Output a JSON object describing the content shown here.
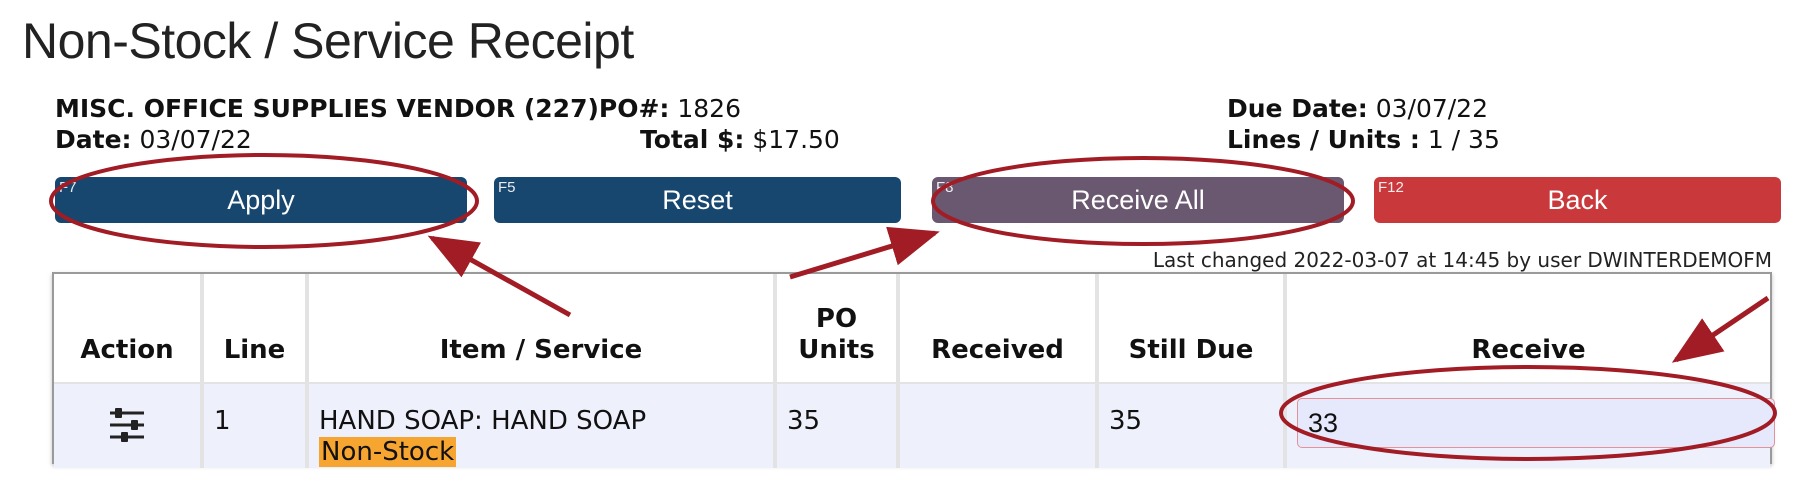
{
  "page": {
    "title": "Non-Stock / Service Receipt"
  },
  "header": {
    "vendor": "MISC. OFFICE SUPPLIES VENDOR (227)",
    "po_label": "PO#:",
    "po_value": "1826",
    "date_label": "Date:",
    "date_value": "03/07/22",
    "total_label": "Total $:",
    "total_value": "$17.50",
    "due_label": "Due Date:",
    "due_value": "03/07/22",
    "lines_label": "Lines / Units :",
    "lines_value": "1 / 35"
  },
  "buttons": {
    "apply": {
      "key": "F7",
      "label": "Apply"
    },
    "reset": {
      "key": "F5",
      "label": "Reset"
    },
    "receive_all": {
      "key": "F8",
      "label": "Receive All"
    },
    "back": {
      "key": "F12",
      "label": "Back"
    }
  },
  "last_changed": "Last changed 2022-03-07 at 14:45 by user DWINTERDEMOFM",
  "table": {
    "headers": {
      "action": "Action",
      "line": "Line",
      "item": "Item / Service",
      "po_units_1": "PO",
      "po_units_2": "Units",
      "received": "Received",
      "still_due": "Still Due",
      "receive": "Receive"
    },
    "rows": [
      {
        "action_icon": "sliders-icon",
        "line": "1",
        "item": "HAND SOAP: HAND SOAP",
        "tag": "Non-Stock",
        "po_units": "35",
        "received": "",
        "still_due": "35",
        "receive": "33"
      }
    ]
  },
  "colors": {
    "primary_button": "#17466f",
    "receive_all_button": "#6a5870",
    "back_button": "#c9393c",
    "annotation": "#a11c24",
    "tag": "#f7a531"
  }
}
